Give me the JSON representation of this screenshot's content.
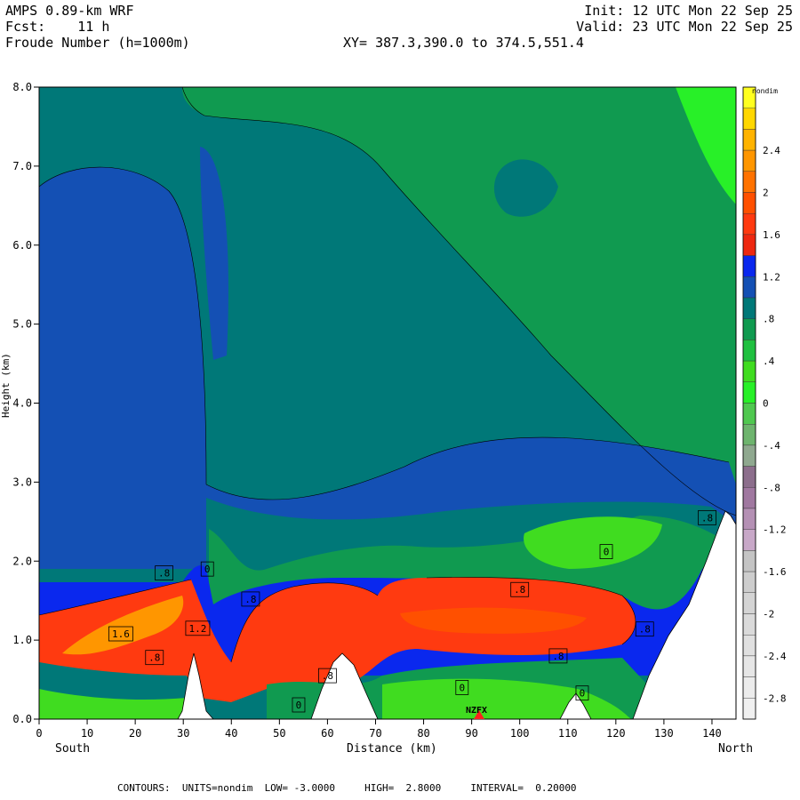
{
  "header": {
    "line1": "AMPS 0.89-km WRF",
    "fcst_label": "Fcst:",
    "fcst_value": "11 h",
    "field": "Froude Number (h=1000m)",
    "init": "Init: 12 UTC Mon 22 Sep 25",
    "valid": "Valid: 23 UTC Mon 22 Sep 25",
    "xy": "XY= 387.3,390.0 to 374.5,551.4"
  },
  "footer": "CONTOURS:  UNITS=nondim  LOW= -3.0000     HIGH=  2.8000     INTERVAL=  0.20000",
  "chart_data": {
    "type": "heatmap",
    "title": "Froude Number (h=1000m)",
    "xlabel": "Distance (km)",
    "ylabel": "Height (km)",
    "xlim": [
      0,
      145
    ],
    "ylim": [
      0,
      8
    ],
    "x_ticks": [
      0,
      10,
      20,
      30,
      40,
      50,
      60,
      70,
      80,
      90,
      100,
      110,
      120,
      130,
      140
    ],
    "y_ticks": [
      "0.0",
      "1.0",
      "2.0",
      "3.0",
      "4.0",
      "5.0",
      "6.0",
      "7.0",
      "8.0"
    ],
    "x_end_labels": {
      "left": "South",
      "right": "North"
    },
    "units": "nondim",
    "contour_low": -3.0,
    "contour_high": 2.8,
    "contour_interval": 0.2,
    "station_label": "NZFX",
    "colorbar_labels": [
      "2.4",
      "2",
      "1.6",
      "1.2",
      ".8",
      ".4",
      "0",
      "-.4",
      "-.8",
      "-1.2",
      "-1.6",
      "-2",
      "-2.4",
      "-2.8"
    ],
    "colorbar_colors": [
      "#ffff20",
      "#ffd700",
      "#ffb300",
      "#ff9600",
      "#ff7200",
      "#ff5000",
      "#ff3a10",
      "#ee2810",
      "#0a28ee",
      "#1450b4",
      "#007878",
      "#109a50",
      "#20c040",
      "#40dc20",
      "#28f028",
      "#50c850",
      "#6eb46e",
      "#8fa88f",
      "#8c6e8c",
      "#a078a0",
      "#b490b4",
      "#c8a8c8",
      "#c4c4c4",
      "#cdcdcd",
      "#d4d4d4",
      "#dadada",
      "#e0e0e0",
      "#e6e6e6",
      "#ececec",
      "#f0f0f0"
    ],
    "contour_labels": [
      {
        "x": 26,
        "y": 1.85,
        "text": ".8"
      },
      {
        "x": 35,
        "y": 1.9,
        "text": "0"
      },
      {
        "x": 44,
        "y": 1.52,
        "text": ".8"
      },
      {
        "x": 17,
        "y": 1.08,
        "text": "1.6"
      },
      {
        "x": 33,
        "y": 1.15,
        "text": "1.2"
      },
      {
        "x": 24,
        "y": 0.78,
        "text": ".8"
      },
      {
        "x": 60,
        "y": 0.55,
        "text": ".8"
      },
      {
        "x": 54,
        "y": 0.18,
        "text": "0"
      },
      {
        "x": 88,
        "y": 0.4,
        "text": "0"
      },
      {
        "x": 108,
        "y": 0.8,
        "text": ".8"
      },
      {
        "x": 113,
        "y": 0.33,
        "text": "0"
      },
      {
        "x": 100,
        "y": 1.64,
        "text": ".8"
      },
      {
        "x": 118,
        "y": 2.12,
        "text": "0"
      },
      {
        "x": 126,
        "y": 1.14,
        "text": ".8"
      },
      {
        "x": 139,
        "y": 2.55,
        "text": ".8"
      }
    ]
  }
}
